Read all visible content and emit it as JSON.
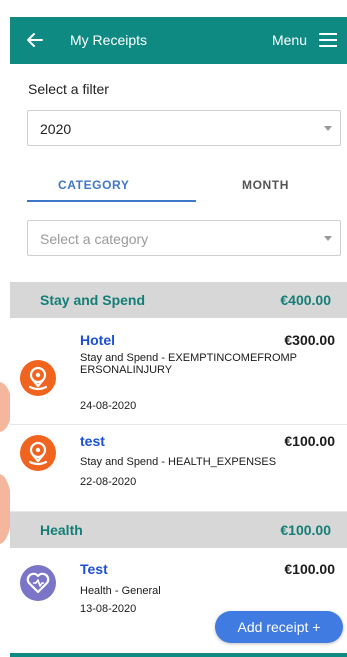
{
  "header": {
    "title": "My Receipts",
    "menu_label": "Menu"
  },
  "filter": {
    "label": "Select a filter",
    "value": "2020"
  },
  "tabs": [
    {
      "label": "CATEGORY",
      "active": true
    },
    {
      "label": "MONTH",
      "active": false
    }
  ],
  "category_select": {
    "placeholder": "Select a category"
  },
  "sections": [
    {
      "name": "Stay and Spend",
      "total": "€400.00",
      "receipts": [
        {
          "name": "Hotel",
          "amount": "€300.00",
          "description": "Stay and Spend - EXEMPTINCOMEFROMPERSONALINJURY",
          "date": "24-08-2020",
          "icon": "map-pin-icon"
        },
        {
          "name": "test",
          "amount": "€100.00",
          "description": "Stay and Spend - HEALTH_EXPENSES",
          "date": "22-08-2020",
          "icon": "map-pin-icon"
        }
      ]
    },
    {
      "name": "Health",
      "total": "€100.00",
      "receipts": [
        {
          "name": "Test",
          "amount": "€100.00",
          "description": "Health - General",
          "date": "13-08-2020",
          "icon": "heart-icon"
        }
      ]
    }
  ],
  "add_receipt": {
    "label": "Add receipt +"
  },
  "colors": {
    "primary": "#0f8a83",
    "accent": "#3f76c9",
    "orange": "#f0641f",
    "purple": "#7b75c7"
  }
}
